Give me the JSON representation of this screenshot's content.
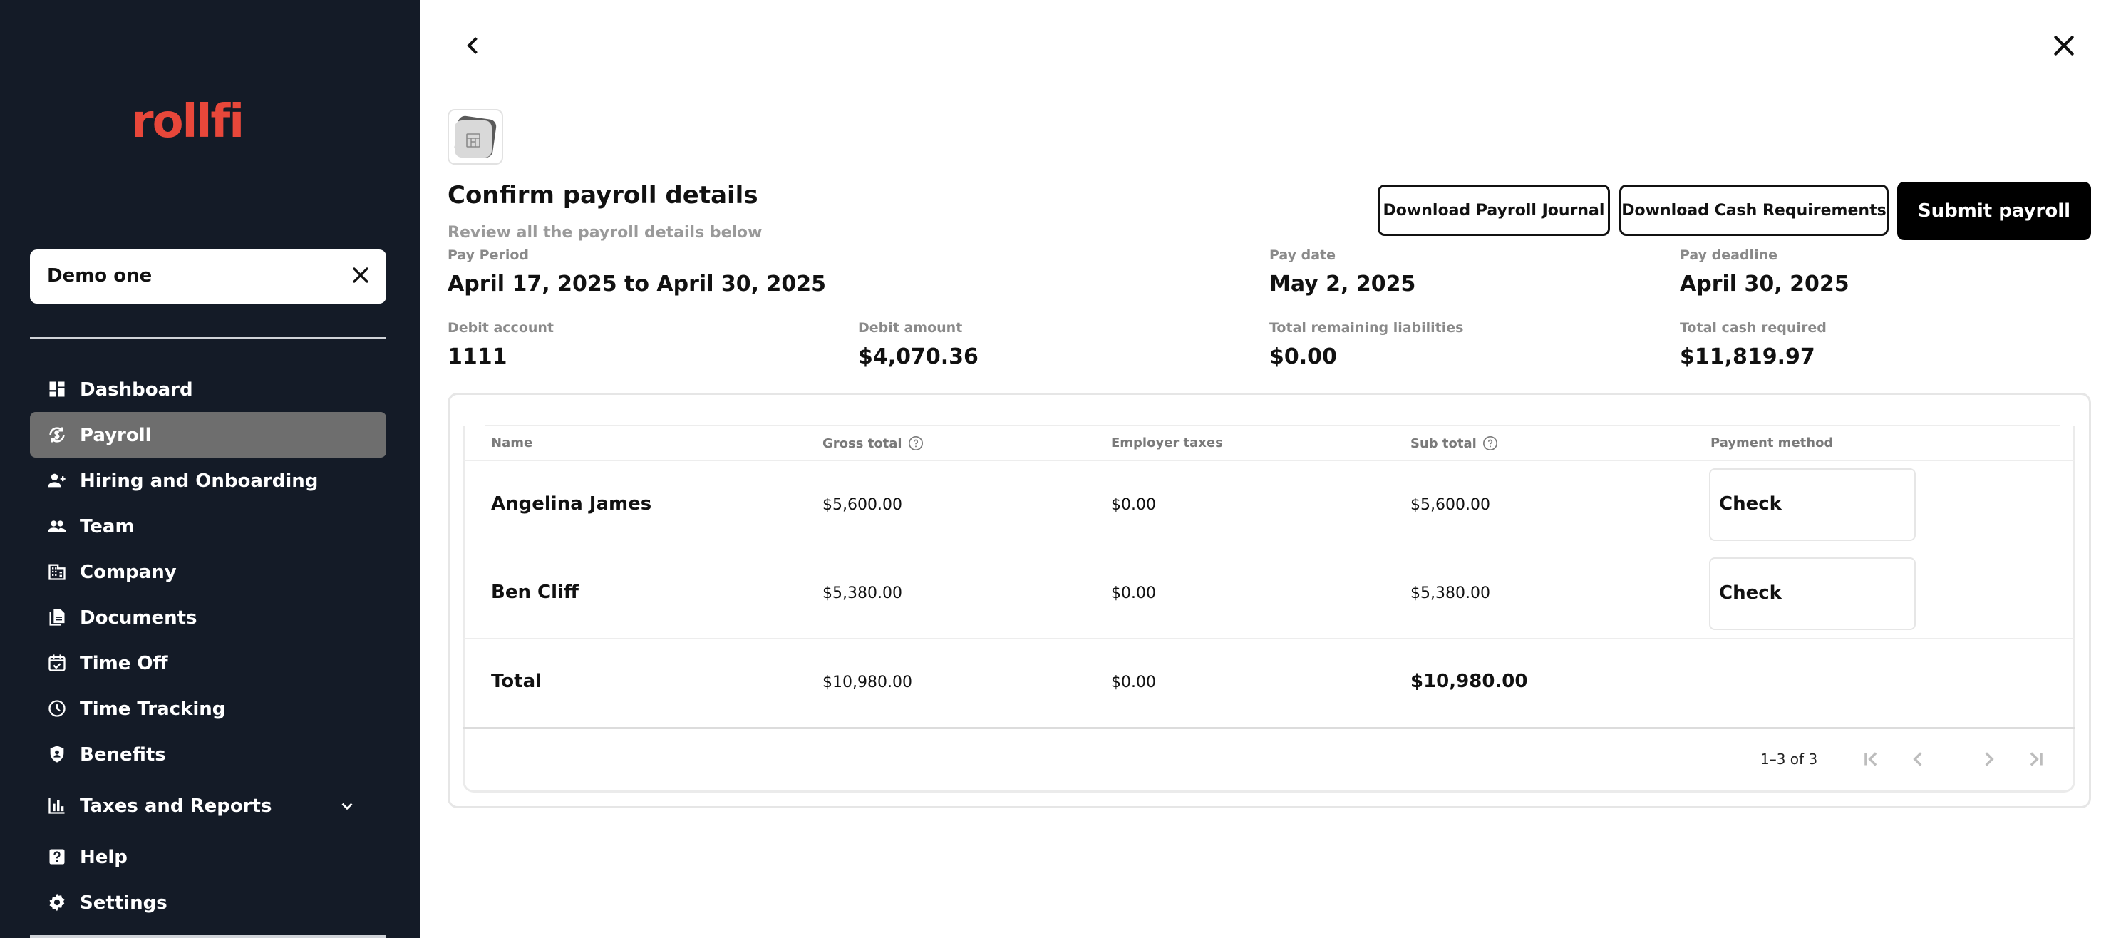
{
  "sidebar": {
    "logo": "rollfi",
    "company_name": "Demo one",
    "items": [
      {
        "label": "Dashboard",
        "icon": "dashboard-icon"
      },
      {
        "label": "Payroll",
        "icon": "payroll-icon",
        "active": true
      },
      {
        "label": "Hiring and Onboarding",
        "icon": "hiring-icon"
      },
      {
        "label": "Team",
        "icon": "team-icon"
      },
      {
        "label": "Company",
        "icon": "company-icon"
      },
      {
        "label": "Documents",
        "icon": "documents-icon"
      },
      {
        "label": "Time Off",
        "icon": "calendar-check-icon"
      },
      {
        "label": "Time Tracking",
        "icon": "clock-icon"
      },
      {
        "label": "Benefits",
        "icon": "shield-icon"
      },
      {
        "label": "Taxes and Reports",
        "icon": "bar-chart-icon",
        "expandable": true
      },
      {
        "label": "Help",
        "icon": "help-icon"
      },
      {
        "label": "Settings",
        "icon": "gear-icon"
      }
    ]
  },
  "header": {
    "title": "Confirm payroll details",
    "subtitle": "Review all the payroll details below",
    "buttons": {
      "download_journal": "Download Payroll Journal",
      "download_cash": "Download Cash Requirements",
      "submit": "Submit payroll"
    }
  },
  "details": {
    "pay_period": {
      "label": "Pay Period",
      "value": "April 17, 2025 to April 30, 2025"
    },
    "pay_date": {
      "label": "Pay date",
      "value": "May 2, 2025"
    },
    "pay_deadline": {
      "label": "Pay deadline",
      "value": "April 30, 2025"
    },
    "debit_account": {
      "label": "Debit account",
      "value": "1111"
    },
    "debit_amount": {
      "label": "Debit amount",
      "value": "$4,070.36"
    },
    "remaining_liabilities": {
      "label": "Total remaining liabilities",
      "value": "$0.00"
    },
    "cash_required": {
      "label": "Total cash required",
      "value": "$11,819.97"
    }
  },
  "table": {
    "columns": [
      "Name",
      "Gross total",
      "Employer taxes",
      "Sub total",
      "Payment method"
    ],
    "rows": [
      {
        "name": "Angelina James",
        "gross": "$5,600.00",
        "taxes": "$0.00",
        "subtotal": "$5,600.00",
        "method": "Check"
      },
      {
        "name": "Ben Cliff",
        "gross": "$5,380.00",
        "taxes": "$0.00",
        "subtotal": "$5,380.00",
        "method": "Check"
      }
    ],
    "total": {
      "name": "Total",
      "gross": "$10,980.00",
      "taxes": "$0.00",
      "subtotal": "$10,980.00"
    },
    "pagination": "1–3 of 3"
  },
  "colors": {
    "sidebar_bg": "#141b27",
    "brand": "#e8473a",
    "active_item": "#6e6e6e"
  }
}
